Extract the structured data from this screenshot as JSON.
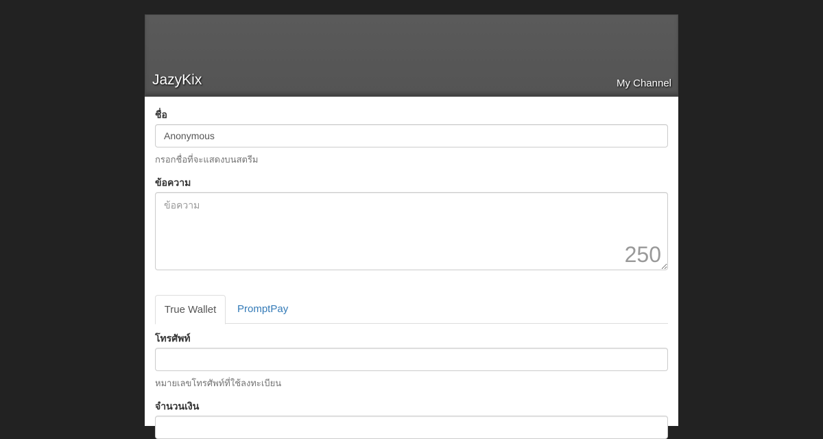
{
  "header": {
    "channel_name": "JazyKix",
    "my_channel_link": "My Channel"
  },
  "form": {
    "name": {
      "label": "ชื่อ",
      "value": "Anonymous",
      "help": "กรอกชื่อที่จะแสดงบนสตรีม"
    },
    "message": {
      "label": "ข้อความ",
      "placeholder": "ข้อความ",
      "counter": "250"
    },
    "tabs": [
      {
        "label": "True Wallet",
        "active": true
      },
      {
        "label": "PromptPay",
        "active": false
      }
    ],
    "phone": {
      "label": "โทรศัพท์",
      "value": "",
      "help": "หมายเลขโทรศัพท์ที่ใช้ลงทะเบียน"
    },
    "amount": {
      "label": "จำนวนเงิน"
    }
  },
  "colors": {
    "page_background": "#222222",
    "banner": "#575757",
    "link": "#337ab7"
  }
}
